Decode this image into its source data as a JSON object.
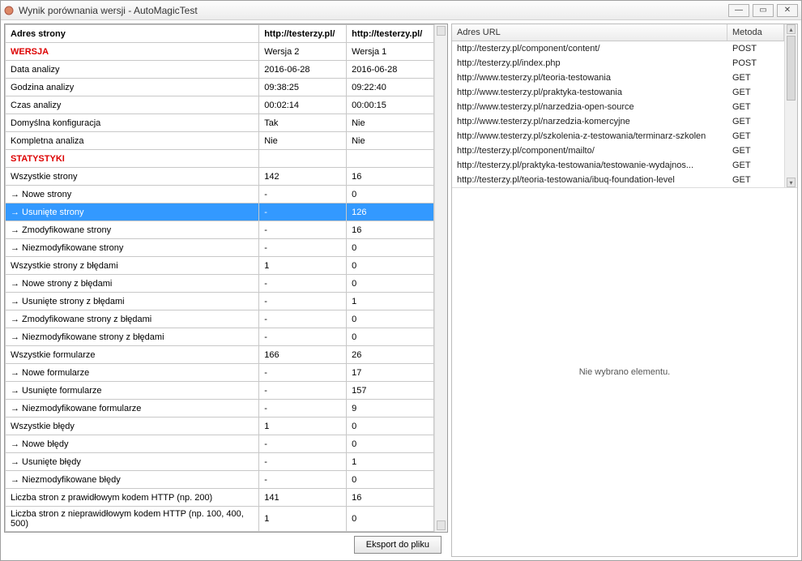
{
  "window": {
    "title": "Wynik porównania wersji - AutoMagicTest"
  },
  "leftTable": {
    "headers": [
      "Adres strony",
      "http://testerzy.pl/",
      "http://testerzy.pl/"
    ],
    "rows": [
      {
        "type": "section",
        "cells": [
          "WERSJA",
          "Wersja 2",
          "Wersja 1"
        ]
      },
      {
        "type": "data",
        "cells": [
          "Data analizy",
          "2016-06-28",
          "2016-06-28"
        ]
      },
      {
        "type": "data",
        "cells": [
          "Godzina analizy",
          "09:38:25",
          "09:22:40"
        ]
      },
      {
        "type": "data",
        "cells": [
          "Czas analizy",
          "00:02:14",
          "00:00:15"
        ]
      },
      {
        "type": "data",
        "cells": [
          "Domyślna konfiguracja",
          "Tak",
          "Nie"
        ]
      },
      {
        "type": "data",
        "cells": [
          "Kompletna analiza",
          "Nie",
          "Nie"
        ]
      },
      {
        "type": "section",
        "cells": [
          "STATYSTYKI",
          "",
          ""
        ]
      },
      {
        "type": "data",
        "cells": [
          "Wszystkie strony",
          "142",
          "16"
        ]
      },
      {
        "type": "data",
        "cells": [
          "→ Nowe strony",
          "-",
          "0"
        ]
      },
      {
        "type": "selected",
        "cells": [
          "→ Usunięte strony",
          "-",
          "126"
        ]
      },
      {
        "type": "data",
        "cells": [
          "→ Zmodyfikowane strony",
          "-",
          "16"
        ]
      },
      {
        "type": "data",
        "cells": [
          "→ Niezmodyfikowane strony",
          "-",
          "0"
        ]
      },
      {
        "type": "data",
        "cells": [
          "Wszystkie strony z błędami",
          "1",
          "0"
        ]
      },
      {
        "type": "data",
        "cells": [
          "→ Nowe strony z błędami",
          "-",
          "0"
        ]
      },
      {
        "type": "data",
        "cells": [
          "→ Usunięte strony z błędami",
          "-",
          "1"
        ]
      },
      {
        "type": "data",
        "cells": [
          "→ Zmodyfikowane strony z błędami",
          "-",
          "0"
        ]
      },
      {
        "type": "data",
        "cells": [
          "→ Niezmodyfikowane strony z błędami",
          "-",
          "0"
        ]
      },
      {
        "type": "data",
        "cells": [
          "Wszystkie formularze",
          "166",
          "26"
        ]
      },
      {
        "type": "data",
        "cells": [
          "→ Nowe formularze",
          "-",
          "17"
        ]
      },
      {
        "type": "data",
        "cells": [
          "→ Usunięte formularze",
          "-",
          "157"
        ]
      },
      {
        "type": "data",
        "cells": [
          "→ Niezmodyfikowane formularze",
          "-",
          "9"
        ]
      },
      {
        "type": "data",
        "cells": [
          "Wszystkie błędy",
          "1",
          "0"
        ]
      },
      {
        "type": "data",
        "cells": [
          "→ Nowe błędy",
          "-",
          "0"
        ]
      },
      {
        "type": "data",
        "cells": [
          "→ Usunięte błędy",
          "-",
          "1"
        ]
      },
      {
        "type": "data",
        "cells": [
          "→ Niezmodyfikowane błędy",
          "-",
          "0"
        ]
      },
      {
        "type": "data",
        "cells": [
          "Liczba stron z prawidłowym kodem HTTP (np. 200)",
          "141",
          "16"
        ]
      },
      {
        "type": "data",
        "cells": [
          "Liczba stron z nieprawidłowym kodem HTTP (np. 100, 400, 500)",
          "1",
          "0"
        ]
      }
    ]
  },
  "urlHeaders": {
    "url": "Adres URL",
    "method": "Metoda"
  },
  "urls": [
    {
      "url": "http://testerzy.pl/component/content/",
      "method": "POST"
    },
    {
      "url": "http://testerzy.pl/index.php",
      "method": "POST"
    },
    {
      "url": "http://www.testerzy.pl/teoria-testowania",
      "method": "GET"
    },
    {
      "url": "http://www.testerzy.pl/praktyka-testowania",
      "method": "GET"
    },
    {
      "url": "http://www.testerzy.pl/narzedzia-open-source",
      "method": "GET"
    },
    {
      "url": "http://www.testerzy.pl/narzedzia-komercyjne",
      "method": "GET"
    },
    {
      "url": "http://www.testerzy.pl/szkolenia-z-testowania/terminarz-szkolen",
      "method": "GET"
    },
    {
      "url": "http://testerzy.pl/component/mailto/",
      "method": "GET"
    },
    {
      "url": "http://testerzy.pl/praktyka-testowania/testowanie-wydajnos...",
      "method": "GET"
    },
    {
      "url": "http://testerzy.pl/teoria-testowania/ibuq-foundation-level",
      "method": "GET"
    }
  ],
  "rightEmpty": "Nie wybrano elementu.",
  "exportBtn": "Eksport do pliku"
}
